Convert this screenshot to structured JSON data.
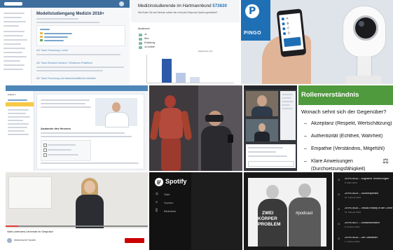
{
  "colors": {
    "moodle_header": "#3d6e9e",
    "moodle_accent": "#4e86b8",
    "pingo_blue": "#1f6fb5",
    "pingo_phone_frame": "#1e1e22",
    "bar_blue": "#2d5aa8",
    "bar_light": "#b9c8e6",
    "spotify_black": "#121212",
    "spotify_green": "#1db954",
    "slide_green": "#4f9a3d",
    "desk_bg": "#34373c"
  },
  "tile1": {
    "title": "Modellstudiengang Medizin 2018+",
    "sections": [
      "AG Track Forschung / Lehre",
      "AG Track Klinische Medizin / Klinisches Praktikum",
      "AG Track Forschung und wissenschaftliches Arbeiten"
    ]
  },
  "tile2": {
    "title": "Medizinstudierende im Hartmannbund",
    "pin": "573630",
    "question": "Wie finden Sie das Studium sollten hier mit Audio-Response-System gearbeitet?",
    "subhead": "Abstimmen",
    "options": [
      "Ja",
      "Nein",
      "Enthaltung",
      "Ja Vorteile"
    ],
    "chart_caption": "Ergebnisse (%)"
  },
  "tile3": {
    "brand": "PINGO",
    "logo_letter": "P",
    "phone_options": [
      "A",
      "B",
      "C",
      "D"
    ]
  },
  "tile4": {
    "module": "Kapitel 1",
    "page_title": "Anatomie des Herzens"
  },
  "tile7": {
    "heading": "Rollenverständnis",
    "question": "Wonach sehnt sich der Gegenüber?",
    "bullets": [
      "Akzeptanz (Respekt, Wertschätzung)",
      "Authentizität (Echtheit, Wahrheit)",
      "Empathie (Verständnis, Mitgefühl)",
      "Klare Anweisungen (Durchsetzungsfähigkeit)"
    ]
  },
  "tile8": {
    "caption": "Video-Interview Lehrende im Gespräch",
    "channel": "Medizinische Fakultät"
  },
  "tile9": {
    "brand": "Spotify",
    "nav": [
      "Start",
      "Suchen",
      "Bibliothek"
    ]
  },
  "tile10": {
    "cover_line1": "ZWEI",
    "cover_line2": "KÖRPER",
    "cover_line3": "PROBLEM",
    "cover_tag": "#podcast"
  },
  "tile11": {
    "episodes": [
      {
        "title": "ZKPB #030 – Kognitive Verzerrungen",
        "date": "8. März 2019"
      },
      {
        "title": "ZKPB #029 – Suchtexperten",
        "date": "22. Februar 2019"
      },
      {
        "title": "ZKPB #028 – Virtual Reality in der Lehre",
        "date": "15. Februar 2019"
      },
      {
        "title": "ZKPB #027 – Einsteinkliniken",
        "date": "8. Februar 2019"
      },
      {
        "title": "ZKPB #026 – Der Zweiteiler",
        "date": "1. Februar 2019"
      }
    ]
  }
}
